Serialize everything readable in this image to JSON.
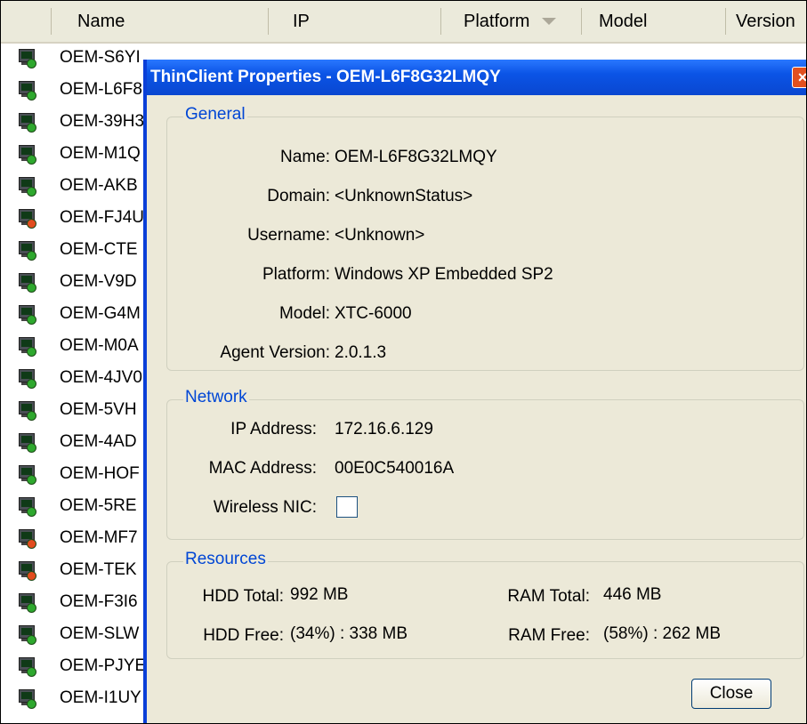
{
  "list": {
    "columns": [
      "Name",
      "IP",
      "Platform",
      "Model",
      "Version"
    ],
    "rows": [
      {
        "name": "OEM-S6YI",
        "status_color": "#2ea82e"
      },
      {
        "name": "OEM-L6F8",
        "status_color": "#2ea82e"
      },
      {
        "name": "OEM-39H3",
        "status_color": "#2ea82e"
      },
      {
        "name": "OEM-M1Q",
        "status_color": "#2ea82e"
      },
      {
        "name": "OEM-AKB",
        "status_color": "#2ea82e"
      },
      {
        "name": "OEM-FJ4U",
        "status_color": "#e24c1e"
      },
      {
        "name": "OEM-CTE",
        "status_color": "#2ea82e"
      },
      {
        "name": "OEM-V9D",
        "status_color": "#2ea82e"
      },
      {
        "name": "OEM-G4M",
        "status_color": "#2ea82e"
      },
      {
        "name": "OEM-M0A",
        "status_color": "#2ea82e"
      },
      {
        "name": "OEM-4JV0",
        "status_color": "#2ea82e"
      },
      {
        "name": "OEM-5VH",
        "status_color": "#2ea82e"
      },
      {
        "name": "OEM-4AD",
        "status_color": "#2ea82e"
      },
      {
        "name": "OEM-HOF",
        "status_color": "#2ea82e"
      },
      {
        "name": "OEM-5RE",
        "status_color": "#2ea82e"
      },
      {
        "name": "OEM-MF7",
        "status_color": "#e24c1e"
      },
      {
        "name": "OEM-TEK",
        "status_color": "#e24c1e"
      },
      {
        "name": "OEM-F3I6",
        "status_color": "#2ea82e"
      },
      {
        "name": "OEM-SLW",
        "status_color": "#2ea82e"
      },
      {
        "name": "OEM-PJYE",
        "status_color": "#2ea82e"
      },
      {
        "name": "OEM-I1UY",
        "status_color": "#2ea82e"
      }
    ]
  },
  "dialog": {
    "title": "ThinClient Properties - OEM-L6F8G32LMQY",
    "close_icon": "close-icon",
    "general": {
      "legend": "General",
      "name_label": "Name:",
      "name_value": "OEM-L6F8G32LMQY",
      "domain_label": "Domain:",
      "domain_value": "<UnknownStatus>",
      "username_label": "Username:",
      "username_value": "<Unknown>",
      "platform_label": "Platform:",
      "platform_value": "Windows XP Embedded SP2",
      "model_label": "Model:",
      "model_value": "XTC-6000",
      "agent_label": "Agent Version:",
      "agent_value": "2.0.1.3"
    },
    "network": {
      "legend": "Network",
      "ip_label": "IP Address:",
      "ip_value": "172.16.6.129",
      "mac_label": "MAC Address:",
      "mac_value": "00E0C540016A",
      "wireless_label": "Wireless NIC:",
      "wireless_checked": false
    },
    "resources": {
      "legend": "Resources",
      "hdd_total_label": "HDD Total:",
      "hdd_total_value": "992 MB",
      "hdd_free_label": "HDD Free:",
      "hdd_free_value": "(34%) : 338 MB",
      "ram_total_label": "RAM Total:",
      "ram_total_value": "446 MB",
      "ram_free_label": "RAM Free:",
      "ram_free_value": "(58%) : 262 MB"
    },
    "close_button": "Close"
  },
  "colors": {
    "title_bar": "#0b54e6",
    "legend_text": "#0046d5",
    "dialog_bg": "#ece9d8"
  }
}
